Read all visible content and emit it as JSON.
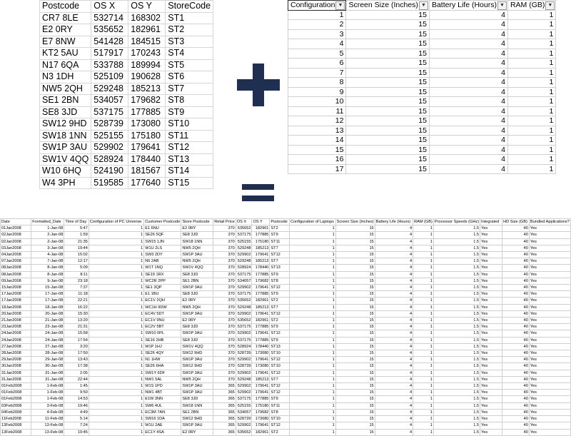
{
  "postcode_table": {
    "headers": [
      "Postcode",
      "OS X",
      "OS Y",
      "StoreCode"
    ],
    "rows": [
      [
        "CR7 8LE",
        "532714",
        "168302",
        "ST1"
      ],
      [
        "E2 0RY",
        "535652",
        "182961",
        "ST2"
      ],
      [
        "E7 8NW",
        "541428",
        "184515",
        "ST3"
      ],
      [
        "KT2 5AU",
        "517917",
        "170243",
        "ST4"
      ],
      [
        "N17 6QA",
        "533788",
        "189994",
        "ST5"
      ],
      [
        "N3 1DH",
        "525109",
        "190628",
        "ST6"
      ],
      [
        "NW5 2QH",
        "529248",
        "185213",
        "ST7"
      ],
      [
        "SE1 2BN",
        "534057",
        "179682",
        "ST8"
      ],
      [
        "SE8 3JD",
        "537175",
        "177885",
        "ST9"
      ],
      [
        "SW12 9HD",
        "528739",
        "173080",
        "ST10"
      ],
      [
        "SW18 1NN",
        "525155",
        "175180",
        "ST11"
      ],
      [
        "SW1P 3AU",
        "529902",
        "179641",
        "ST12"
      ],
      [
        "SW1V 4QQ",
        "528924",
        "178440",
        "ST13"
      ],
      [
        "W10 6HQ",
        "524190",
        "181567",
        "ST14"
      ],
      [
        "W4 3PH",
        "519585",
        "177640",
        "ST15"
      ]
    ]
  },
  "config_table": {
    "headers": [
      "Configuration",
      "Screen Size (Inches)",
      "Battery Life (Hours)",
      "RAM (GB)"
    ],
    "dropdown_glyph": "▼",
    "rows": [
      [
        "1",
        "15",
        "4",
        "1"
      ],
      [
        "2",
        "15",
        "4",
        "1"
      ],
      [
        "3",
        "15",
        "4",
        "1"
      ],
      [
        "4",
        "15",
        "4",
        "1"
      ],
      [
        "5",
        "15",
        "4",
        "1"
      ],
      [
        "6",
        "15",
        "4",
        "1"
      ],
      [
        "7",
        "15",
        "4",
        "1"
      ],
      [
        "8",
        "15",
        "4",
        "1"
      ],
      [
        "9",
        "15",
        "4",
        "1"
      ],
      [
        "10",
        "15",
        "4",
        "1"
      ],
      [
        "11",
        "15",
        "4",
        "1"
      ],
      [
        "12",
        "15",
        "4",
        "1"
      ],
      [
        "13",
        "15",
        "4",
        "1"
      ],
      [
        "14",
        "15",
        "4",
        "1"
      ],
      [
        "15",
        "15",
        "4",
        "1"
      ],
      [
        "16",
        "15",
        "4",
        "1"
      ],
      [
        "17",
        "15",
        "4",
        "1"
      ]
    ]
  },
  "merged_table": {
    "headers": [
      "Date",
      "Formatted_Date",
      "Time of Day",
      "Configuration of PC Universe",
      "Customer Postcode",
      "Store Postcode",
      "Retail Price",
      "OS X",
      "OS Y",
      "Postcode",
      "Configuration of Laptops",
      "Screen Size (Inches)",
      "Battery Life (Hours)",
      "RAM (GB)",
      "Processor Speeds (GHz)",
      "Integrated",
      "HD Size (GB)",
      "Bundled Applications?"
    ],
    "rows": [
      [
        "01Jan2008",
        "1-Jan-08",
        "5:47",
        "1",
        "E1 6NU",
        "E2 0RY",
        "370",
        "535652",
        "182961",
        "ST2",
        "1",
        "15",
        "4",
        "1",
        "1.5",
        "Yes",
        "40",
        "Yes"
      ],
      [
        "02Jan2008",
        "2-Jan-08",
        "1:59",
        "1",
        "SE26 5QF",
        "SE8 3JD",
        "370",
        "537175",
        "177885",
        "ST9",
        "1",
        "15",
        "4",
        "1",
        "1.5",
        "Yes",
        "40",
        "Yes"
      ],
      [
        "02Jan2008",
        "2-Jan-08",
        "21:35",
        "1",
        "SW15 1JN",
        "SW18 1NN",
        "370",
        "525155",
        "175180",
        "ST11",
        "1",
        "15",
        "4",
        "1",
        "1.5",
        "Yes",
        "40",
        "Yes"
      ],
      [
        "03Jan2008",
        "3-Jan-08",
        "19:44",
        "1",
        "W1U 2LS",
        "NW5 2QH",
        "370",
        "529248",
        "185213",
        "ST7",
        "1",
        "15",
        "4",
        "1",
        "1.5",
        "Yes",
        "40",
        "Yes"
      ],
      [
        "04Jan2008",
        "4-Jan-08",
        "15:02",
        "1",
        "SW3 2DY",
        "SW1P 3AU",
        "370",
        "529902",
        "179641",
        "ST12",
        "1",
        "15",
        "4",
        "1",
        "1.5",
        "Yes",
        "40",
        "Yes"
      ],
      [
        "07Jan2008",
        "7-Jan-08",
        "12:17",
        "1",
        "N5 2AB",
        "NW5 2QH",
        "370",
        "529248",
        "185213",
        "ST7",
        "1",
        "15",
        "4",
        "1",
        "1.5",
        "Yes",
        "40",
        "Yes"
      ],
      [
        "08Jan2008",
        "8-Jan-08",
        "5:09",
        "1",
        "W1T 1NQ",
        "SW1V 4QQ",
        "370",
        "528924",
        "178440",
        "ST13",
        "1",
        "15",
        "4",
        "1",
        "1.5",
        "Yes",
        "40",
        "Yes"
      ],
      [
        "08Jan2008",
        "8-Jan-08",
        "8:11",
        "1",
        "SE19 1RX",
        "SE8 3JD",
        "370",
        "537175",
        "177885",
        "ST9",
        "1",
        "15",
        "4",
        "1",
        "1.5",
        "Yes",
        "40",
        "Yes"
      ],
      [
        "09Jan2008",
        "9-Jan-08",
        "23:18",
        "1",
        "WC2R 2PP",
        "SE1 2BN",
        "370",
        "534057",
        "179682",
        "ST8",
        "1",
        "15",
        "4",
        "1",
        "1.5",
        "Yes",
        "40",
        "Yes"
      ],
      [
        "15Jan2008",
        "15-Jan-08",
        "7:37",
        "1",
        "SE1 3QP",
        "SW1P 3AU",
        "370",
        "529902",
        "179641",
        "ST12",
        "1",
        "15",
        "4",
        "1",
        "1.5",
        "Yes",
        "40",
        "Yes"
      ],
      [
        "17Jan2008",
        "17-Jan-08",
        "11:18",
        "1",
        "E1 1BU",
        "SE8 3JD",
        "370",
        "537175",
        "177885",
        "ST9",
        "1",
        "15",
        "4",
        "1",
        "1.5",
        "Yes",
        "40",
        "Yes"
      ],
      [
        "17Jan2008",
        "17-Jan-08",
        "22:21",
        "1",
        "EC1V 2QH",
        "E2 0RY",
        "370",
        "535652",
        "182961",
        "ST2",
        "1",
        "15",
        "4",
        "1",
        "1.5",
        "Yes",
        "40",
        "Yes"
      ],
      [
        "18Jan2008",
        "18-Jan-08",
        "16:22",
        "1",
        "WC1H 9DW",
        "NW5 2QH",
        "370",
        "529248",
        "185213",
        "ST7",
        "1",
        "15",
        "4",
        "1",
        "1.5",
        "Yes",
        "40",
        "Yes"
      ],
      [
        "20Jan2008",
        "20-Jan-08",
        "15:30",
        "1",
        "EC4V 5DT",
        "SW1P 3AU",
        "370",
        "529902",
        "179641",
        "ST12",
        "1",
        "15",
        "4",
        "1",
        "1.5",
        "Yes",
        "40",
        "Yes"
      ],
      [
        "21Jan2008",
        "21-Jan-08",
        "13:20",
        "1",
        "EC1V 9NU",
        "E2 0RY",
        "370",
        "535652",
        "182961",
        "ST2",
        "1",
        "15",
        "4",
        "1",
        "1.5",
        "Yes",
        "40",
        "Yes"
      ],
      [
        "23Jan2008",
        "23-Jan-08",
        "21:31",
        "1",
        "EC2V 5BT",
        "SE8 3JD",
        "370",
        "537175",
        "177885",
        "ST9",
        "1",
        "15",
        "4",
        "1",
        "1.5",
        "Yes",
        "40",
        "Yes"
      ],
      [
        "24Jan2008",
        "24-Jan-08",
        "15:58",
        "1",
        "SW10 0PL",
        "SW1P 3AU",
        "370",
        "529902",
        "179641",
        "ST12",
        "1",
        "15",
        "4",
        "1",
        "1.5",
        "Yes",
        "40",
        "Yes"
      ],
      [
        "24Jan2008",
        "24-Jan-08",
        "17:54",
        "1",
        "SE16 2HB",
        "SE8 3JD",
        "370",
        "537175",
        "177885",
        "ST9",
        "1",
        "15",
        "4",
        "1",
        "1.5",
        "Yes",
        "40",
        "Yes"
      ],
      [
        "27Jan2008",
        "27-Jan-08",
        "3:20",
        "1",
        "W1P 1HJ",
        "SW1V 4QQ",
        "370",
        "528924",
        "178440",
        "ST13",
        "1",
        "15",
        "4",
        "1",
        "1.5",
        "Yes",
        "40",
        "Yes"
      ],
      [
        "28Jan2008",
        "28-Jan-08",
        "17:50",
        "1",
        "SE26 4QY",
        "SW12 9HD",
        "370",
        "528739",
        "173080",
        "ST10",
        "1",
        "15",
        "4",
        "1",
        "1.5",
        "Yes",
        "40",
        "Yes"
      ],
      [
        "29Jan2008",
        "29-Jan-08",
        "13:43",
        "1",
        "N1 1HW",
        "SW1P 3AU",
        "370",
        "529902",
        "179641",
        "ST12",
        "1",
        "15",
        "4",
        "1",
        "1.5",
        "Yes",
        "40",
        "Yes"
      ],
      [
        "30Jan2008",
        "30-Jan-08",
        "17:38",
        "1",
        "SE26 6HA",
        "SW12 9HD",
        "370",
        "528739",
        "173080",
        "ST10",
        "1",
        "15",
        "4",
        "1",
        "1.5",
        "Yes",
        "40",
        "Yes"
      ],
      [
        "31Jan2008",
        "31-Jan-08",
        "2:05",
        "1",
        "SW1Y 6DF",
        "SW1P 3AU",
        "370",
        "529902",
        "179641",
        "ST12",
        "1",
        "15",
        "4",
        "1",
        "1.5",
        "Yes",
        "40",
        "Yes"
      ],
      [
        "31Jan2008",
        "31-Jan-08",
        "22:44",
        "1",
        "NW1 5AL",
        "NW5 2QH",
        "370",
        "529248",
        "185213",
        "ST7",
        "1",
        "15",
        "4",
        "1",
        "1.5",
        "Yes",
        "40",
        "Yes"
      ],
      [
        "01Feb2008",
        "1-Feb-08",
        "1:45",
        "1",
        "W1S 1PD",
        "SW1P 3AU",
        "365",
        "529902",
        "179641",
        "ST12",
        "1",
        "15",
        "4",
        "1",
        "1.5",
        "Yes",
        "40",
        "Yes"
      ],
      [
        "01Feb2008",
        "1-Feb-08",
        "9:50",
        "1",
        "NW1 4BT",
        "SW1P 3AU",
        "365",
        "529902",
        "179641",
        "ST12",
        "1",
        "15",
        "4",
        "1",
        "1.5",
        "Yes",
        "40",
        "Yes"
      ],
      [
        "01Feb2008",
        "1-Feb-08",
        "14:53",
        "1",
        "E1W 3NN",
        "SE8 3JD",
        "365",
        "537175",
        "177885",
        "ST9",
        "1",
        "15",
        "4",
        "1",
        "1.5",
        "Yes",
        "40",
        "Yes"
      ],
      [
        "03Feb2008",
        "3-Feb-08",
        "19:46",
        "1",
        "SW6 4UL",
        "SW18 1NN",
        "365",
        "525155",
        "175180",
        "ST11",
        "1",
        "15",
        "4",
        "1",
        "1.5",
        "Yes",
        "40",
        "Yes"
      ],
      [
        "04Feb2008",
        "4-Feb-08",
        "4:49",
        "1",
        "EC3M 7AN",
        "SE1 2BN",
        "365",
        "534057",
        "179682",
        "ST8",
        "1",
        "15",
        "4",
        "1",
        "1.5",
        "Yes",
        "40",
        "Yes"
      ],
      [
        "11Feb2008",
        "11-Feb-08",
        "5:14",
        "1",
        "SW16 1DA",
        "SW12 9HD",
        "365",
        "528739",
        "173080",
        "ST10",
        "1",
        "15",
        "4",
        "1",
        "1.5",
        "Yes",
        "40",
        "Yes"
      ],
      [
        "13Feb2008",
        "13-Feb-08",
        "7:24",
        "1",
        "W1U 2AE",
        "SW1P 3AU",
        "365",
        "529902",
        "179641",
        "ST12",
        "1",
        "15",
        "4",
        "1",
        "1.5",
        "Yes",
        "40",
        "Yes"
      ],
      [
        "13Feb2008",
        "13-Feb-08",
        "10:45",
        "1",
        "EC1Y 4SA",
        "E2 0RY",
        "365",
        "535652",
        "182961",
        "ST2",
        "1",
        "15",
        "4",
        "1",
        "1.5",
        "Yes",
        "40",
        "Yes"
      ]
    ]
  },
  "colors": {
    "operator": "#1e2f52"
  }
}
